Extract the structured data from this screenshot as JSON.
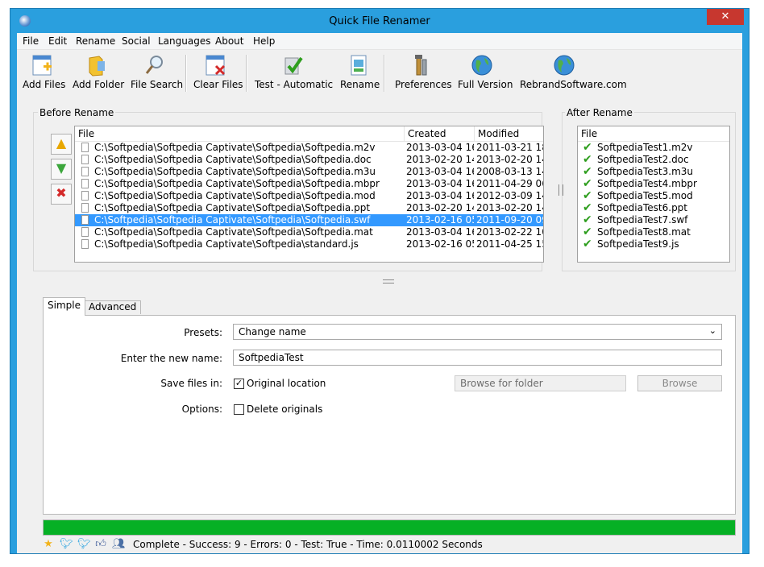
{
  "window": {
    "title": "Quick File Renamer",
    "close": "✕"
  },
  "menu": [
    "File",
    "Edit",
    "Rename",
    "Social",
    "Languages",
    "About",
    "Help"
  ],
  "toolbar": {
    "add_files": "Add Files",
    "add_folder": "Add Folder",
    "file_search": "File Search",
    "clear_files": "Clear Files",
    "test_automatic": "Test - Automatic",
    "rename": "Rename",
    "preferences": "Preferences",
    "full_version": "Full Version",
    "rebrand": "RebrandSoftware.com"
  },
  "before": {
    "title": "Before Rename",
    "columns": [
      "File",
      "Created",
      "Modified"
    ],
    "rows": [
      [
        "C:\\Softpedia\\Softpedia Captivate\\Softpedia\\Softpedia.m2v",
        "2013-03-04 16...",
        "2011-03-21 18..."
      ],
      [
        "C:\\Softpedia\\Softpedia Captivate\\Softpedia\\Softpedia.doc",
        "2013-02-20 14...",
        "2013-02-20 14..."
      ],
      [
        "C:\\Softpedia\\Softpedia Captivate\\Softpedia\\Softpedia.m3u",
        "2013-03-04 16...",
        "2008-03-13 14..."
      ],
      [
        "C:\\Softpedia\\Softpedia Captivate\\Softpedia\\Softpedia.mbpr",
        "2013-03-04 16...",
        "2011-04-29 06..."
      ],
      [
        "C:\\Softpedia\\Softpedia Captivate\\Softpedia\\Softpedia.mod",
        "2013-03-04 16...",
        "2012-03-09 14..."
      ],
      [
        "C:\\Softpedia\\Softpedia Captivate\\Softpedia\\Softpedia.ppt",
        "2013-02-20 14...",
        "2013-02-20 14..."
      ],
      [
        "C:\\Softpedia\\Softpedia Captivate\\Softpedia\\Softpedia.swf",
        "2013-02-16 05...",
        "2011-09-20 09..."
      ],
      [
        "C:\\Softpedia\\Softpedia Captivate\\Softpedia\\Softpedia.mat",
        "2013-03-04 16...",
        "2013-02-22 10..."
      ],
      [
        "C:\\Softpedia\\Softpedia Captivate\\Softpedia\\standard.js",
        "2013-02-16 05...",
        "2011-04-25 15..."
      ]
    ],
    "selected_row": 6
  },
  "after": {
    "title": "After Rename",
    "column": "File",
    "rows": [
      "SoftpediaTest1.m2v",
      "SoftpediaTest2.doc",
      "SoftpediaTest3.m3u",
      "SoftpediaTest4.mbpr",
      "SoftpediaTest5.mod",
      "SoftpediaTest6.ppt",
      "SoftpediaTest7.swf",
      "SoftpediaTest8.mat",
      "SoftpediaTest9.js"
    ]
  },
  "tabs": {
    "simple": "Simple",
    "advanced": "Advanced"
  },
  "form": {
    "presets_label": "Presets:",
    "presets_value": "Change name",
    "new_name_label": "Enter the new name:",
    "new_name_value": "SoftpediaTest",
    "save_label": "Save files in:",
    "original_location": "Original location",
    "browse_placeholder": "Browse for folder",
    "browse_button": "Browse",
    "options_label": "Options:",
    "delete_originals": "Delete originals"
  },
  "progress": {
    "percent": 100,
    "color": "#06b025"
  },
  "status": "Complete - Success: 9 - Errors: 0 - Test: True - Time: 0.0110002 Seconds",
  "colors": {
    "selection": "#3399ff",
    "frame": "#2a9fde",
    "close": "#c7372f"
  }
}
